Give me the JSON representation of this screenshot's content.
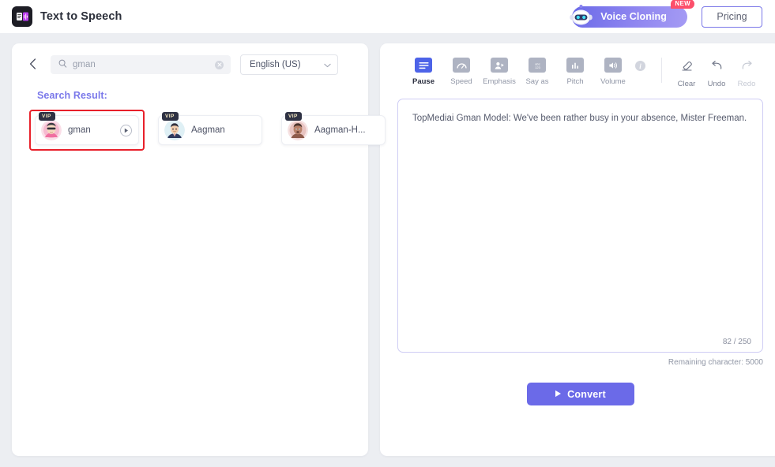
{
  "header": {
    "logo_icon": "app-logo-icon",
    "title": "Text to Speech",
    "voice_cloning_label": "Voice Cloning",
    "voice_cloning_icon": "robot-icon",
    "new_badge": "NEW",
    "pricing_label": "Pricing"
  },
  "left_panel": {
    "back_icon": "chevron-left-icon",
    "search": {
      "icon": "search-icon",
      "value": "gman",
      "placeholder": "gman",
      "clear_icon": "close-circle-icon"
    },
    "language": {
      "value": "English (US)",
      "chevron_icon": "chevron-down-icon"
    },
    "results_title": "Search Result:",
    "voices": [
      {
        "name": "gman",
        "badge": "VIP",
        "selected": true,
        "play_icon": "play-circle-icon",
        "avatar": "avatar-gman"
      },
      {
        "name": "Aagman",
        "badge": "VIP",
        "selected": false,
        "avatar": "avatar-aagman"
      },
      {
        "name": "Aagman-H...",
        "badge": "VIP",
        "selected": false,
        "avatar": "avatar-aagman-h"
      }
    ]
  },
  "right_panel": {
    "tools": [
      {
        "label": "Pause",
        "icon": "pause-marker-icon",
        "active": true
      },
      {
        "label": "Speed",
        "icon": "speed-gauge-icon",
        "active": false
      },
      {
        "label": "Emphasis",
        "icon": "emphasis-icon",
        "active": false
      },
      {
        "label": "Say as",
        "icon": "say-as-icon",
        "active": false
      },
      {
        "label": "Pitch",
        "icon": "pitch-bars-icon",
        "active": false
      },
      {
        "label": "Volume",
        "icon": "volume-speaker-icon",
        "active": false
      }
    ],
    "info_icon": "info-icon",
    "info_glyph": "i",
    "actions": [
      {
        "label": "Clear",
        "icon": "eraser-icon",
        "disabled": false
      },
      {
        "label": "Undo",
        "icon": "undo-arrow-icon",
        "disabled": false
      },
      {
        "label": "Redo",
        "icon": "redo-arrow-icon",
        "disabled": true
      }
    ],
    "editor": {
      "text": "TopMediai Gman Model: We've been rather busy in your absence, Mister Freeman.",
      "char_count": "82 / 250",
      "remaining": "Remaining character: 5000"
    },
    "convert_label": "Convert",
    "convert_icon": "play-icon"
  },
  "colors": {
    "accent": "#6b6ae8",
    "accent_text": "#7a78ea",
    "selection_border": "#e8202a",
    "badge_new": "#fc4f6b",
    "page_bg": "#eceef2",
    "tool_active": "#4d63e8"
  }
}
